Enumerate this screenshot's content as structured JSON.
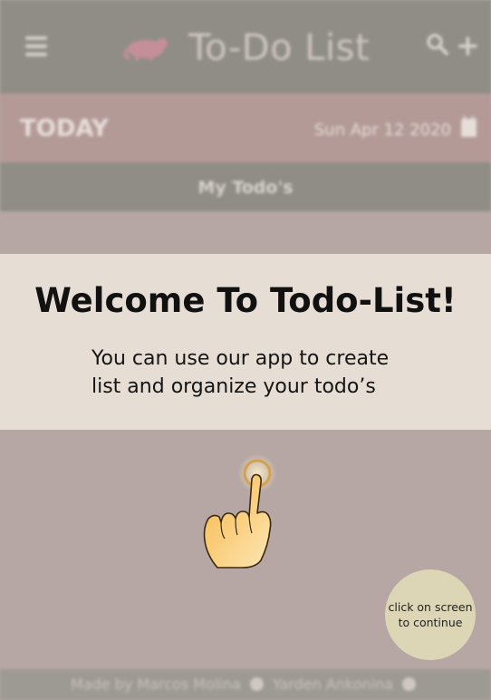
{
  "header": {
    "title": "To-Do List"
  },
  "today": {
    "label": "TODAY",
    "date": "Sun Apr 12 2020"
  },
  "todos": {
    "title": "My Todo's"
  },
  "footer": {
    "author1": "Made by Marcos Molina",
    "author2": "Yarden Ankonina"
  },
  "onboarding": {
    "title": "Welcome To Todo-List!",
    "line1": "You can use our app to create",
    "line2": "list and organize your todo’s",
    "continue": "click on screen to continue"
  },
  "colors": {
    "header_bg": "#8f8d86",
    "today_bg": "#b39a97",
    "overlay_bg": "#e6ddd4",
    "badge_bg": "#dcd6b6"
  },
  "icons": [
    "menu-icon",
    "logo-icon",
    "search-icon",
    "add-icon",
    "calendar-icon",
    "github-icon",
    "tap-hand-icon"
  ]
}
